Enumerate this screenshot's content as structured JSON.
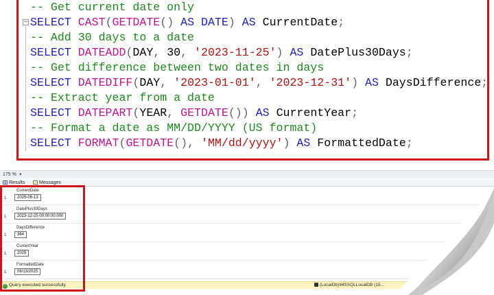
{
  "editor": {
    "lines": [
      {
        "segments": [
          {
            "t": "-- Get current date only",
            "c": "cm"
          }
        ]
      },
      {
        "segments": [
          {
            "t": "SELECT ",
            "c": "kw"
          },
          {
            "t": "CAST",
            "c": "fn"
          },
          {
            "t": "(",
            "c": "op"
          },
          {
            "t": "GETDATE",
            "c": "fn"
          },
          {
            "t": "() ",
            "c": "op"
          },
          {
            "t": "AS ",
            "c": "kw"
          },
          {
            "t": "DATE",
            "c": "kw"
          },
          {
            "t": ") ",
            "c": "op"
          },
          {
            "t": "AS ",
            "c": "kw"
          },
          {
            "t": "CurrentDate",
            "c": "ident"
          },
          {
            "t": ";",
            "c": "op"
          }
        ]
      },
      {
        "segments": [
          {
            "t": "-- Add 30 days to a date",
            "c": "cm"
          }
        ]
      },
      {
        "segments": [
          {
            "t": "SELECT ",
            "c": "kw"
          },
          {
            "t": "DATEADD",
            "c": "fn"
          },
          {
            "t": "(",
            "c": "op"
          },
          {
            "t": "DAY",
            "c": "ident"
          },
          {
            "t": ", ",
            "c": "op"
          },
          {
            "t": "30",
            "c": "ident"
          },
          {
            "t": ", ",
            "c": "op"
          },
          {
            "t": "'2023-11-25'",
            "c": "str"
          },
          {
            "t": ") ",
            "c": "op"
          },
          {
            "t": "AS ",
            "c": "kw"
          },
          {
            "t": "DatePlus30Days",
            "c": "ident"
          },
          {
            "t": ";",
            "c": "op"
          }
        ]
      },
      {
        "segments": [
          {
            "t": "-- Get difference between two dates in days",
            "c": "cm"
          }
        ]
      },
      {
        "segments": [
          {
            "t": "SELECT ",
            "c": "kw"
          },
          {
            "t": "DATEDIFF",
            "c": "fn"
          },
          {
            "t": "(",
            "c": "op"
          },
          {
            "t": "DAY",
            "c": "ident"
          },
          {
            "t": ", ",
            "c": "op"
          },
          {
            "t": "'2023-01-01'",
            "c": "str"
          },
          {
            "t": ", ",
            "c": "op"
          },
          {
            "t": "'2023-12-31'",
            "c": "str"
          },
          {
            "t": ") ",
            "c": "op"
          },
          {
            "t": "AS ",
            "c": "kw"
          },
          {
            "t": "DaysDifference",
            "c": "ident"
          },
          {
            "t": ";",
            "c": "op"
          }
        ]
      },
      {
        "segments": [
          {
            "t": "-- Extract year from a date",
            "c": "cm"
          }
        ]
      },
      {
        "segments": [
          {
            "t": "SELECT ",
            "c": "kw"
          },
          {
            "t": "DATEPART",
            "c": "fn"
          },
          {
            "t": "(",
            "c": "op"
          },
          {
            "t": "YEAR",
            "c": "ident"
          },
          {
            "t": ", ",
            "c": "op"
          },
          {
            "t": "GETDATE",
            "c": "fn"
          },
          {
            "t": "()) ",
            "c": "op"
          },
          {
            "t": "AS ",
            "c": "kw"
          },
          {
            "t": "CurrentYear",
            "c": "ident"
          },
          {
            "t": ";",
            "c": "op"
          }
        ]
      },
      {
        "segments": [
          {
            "t": "-- Format a date as MM/DD/YYYY (US format)",
            "c": "cm"
          }
        ]
      },
      {
        "segments": [
          {
            "t": "SELECT ",
            "c": "kw"
          },
          {
            "t": "FORMAT",
            "c": "fn"
          },
          {
            "t": "(",
            "c": "op"
          },
          {
            "t": "GETDATE",
            "c": "fn"
          },
          {
            "t": "(), ",
            "c": "op"
          },
          {
            "t": "'MM/dd/yyyy'",
            "c": "str"
          },
          {
            "t": ") ",
            "c": "op"
          },
          {
            "t": "AS ",
            "c": "kw"
          },
          {
            "t": "FormattedDate",
            "c": "ident"
          },
          {
            "t": ";",
            "c": "op"
          }
        ]
      }
    ]
  },
  "zoom": {
    "value": "175 %"
  },
  "tabs": {
    "results_label": "Results",
    "messages_label": "Messages"
  },
  "results": [
    {
      "column": "CurrentDate",
      "row": "1",
      "value": "2025-06-13"
    },
    {
      "column": "DatePlus30Days",
      "row": "1",
      "value": "2023-12-25 00:00:00.000"
    },
    {
      "column": "DaysDifference",
      "row": "1",
      "value": "364"
    },
    {
      "column": "CurrentYear",
      "row": "1",
      "value": "2025"
    },
    {
      "column": "FormattedDate",
      "row": "1",
      "value": "06/13/2025"
    }
  ],
  "status": {
    "message": "Query executed successfully.",
    "server": "(LocalDb)\\MSSQLLocalDB (15..."
  },
  "colors": {
    "keyword": "#1e1ec8",
    "function": "#c4148c",
    "string": "#b31212",
    "comment": "#1d8a1d",
    "highlight_border": "#d0121b",
    "status_bar": "#fff5c2"
  },
  "icons": [
    "results-grid-icon",
    "messages-icon",
    "success-check-icon",
    "lock-icon",
    "collapse-minus-icon"
  ]
}
